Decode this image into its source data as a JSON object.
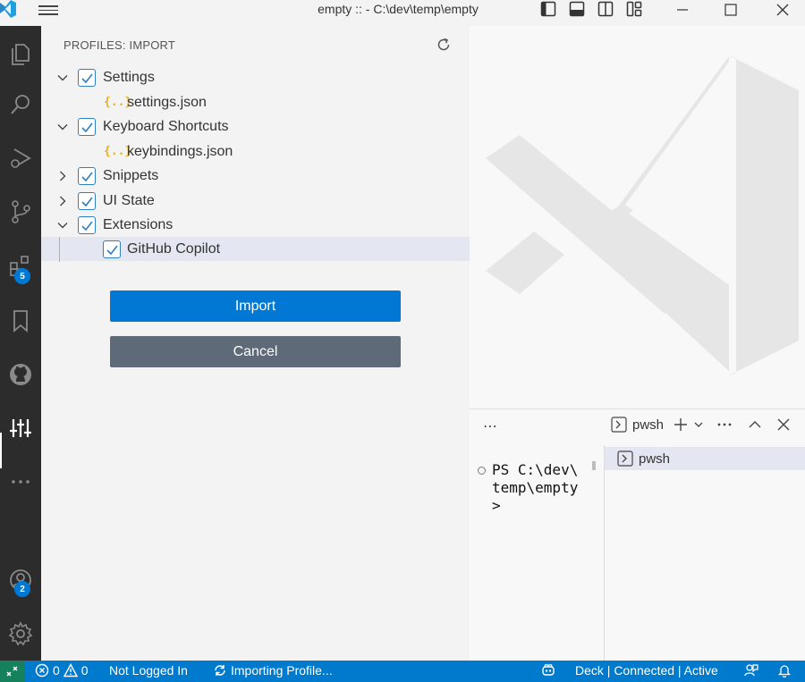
{
  "window": {
    "title": "empty :: - C:\\dev\\temp\\empty"
  },
  "activity_bar": {
    "extensions_badge": "5",
    "accounts_badge": "2"
  },
  "sidebar": {
    "title": "PROFILES: IMPORT",
    "tree": {
      "settings": {
        "label": "Settings",
        "checked": true,
        "expanded": true
      },
      "settings_file": {
        "label": "settings.json",
        "icon": "{..}"
      },
      "keyboard": {
        "label": "Keyboard Shortcuts",
        "checked": true,
        "expanded": true
      },
      "keybindings_file": {
        "label": "keybindings.json",
        "icon": "{..}"
      },
      "snippets": {
        "label": "Snippets",
        "checked": true,
        "expanded": false
      },
      "ui_state": {
        "label": "UI State",
        "checked": true,
        "expanded": false
      },
      "extensions": {
        "label": "Extensions",
        "checked": true,
        "expanded": true
      },
      "copilot": {
        "label": "GitHub Copilot",
        "checked": true
      }
    },
    "import_label": "Import",
    "cancel_label": "Cancel"
  },
  "panel": {
    "terminal_tab_label": "pwsh",
    "terminal_output": "PS C:\\dev\\\ntemp\\empty\n>",
    "terminal_list_item": "pwsh"
  },
  "statusbar": {
    "errors": "0",
    "warnings": "0",
    "login": "Not Logged In",
    "importing": "Importing Profile...",
    "deck": "Deck | Connected | Active"
  },
  "colors": {
    "accent": "#0078d4",
    "statusbar": "#007acc",
    "remote": "#16825d",
    "activitybar": "#2c2c2c",
    "cancel": "#5f6a79"
  }
}
